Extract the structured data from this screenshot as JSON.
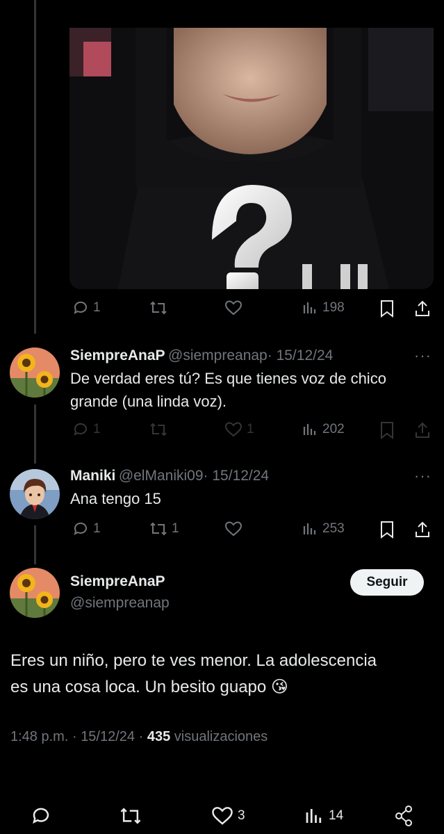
{
  "media_post": {
    "actions": {
      "reply_count": "1",
      "views": "198"
    }
  },
  "reply1": {
    "display_name": "SiempreAnaP",
    "handle": "@siempreanap",
    "date": "· 15/12/24",
    "more": "···",
    "text_line1": "De verdad eres tú? Es que tienes voz de chico",
    "text_line2": "grande (una linda voz).",
    "reply_count": "1",
    "like_count": "1",
    "views": "202"
  },
  "reply2": {
    "display_name": "Maniki",
    "handle": "@elManiki09",
    "date": "· 15/12/24",
    "more": "···",
    "text": "Ana tengo 15",
    "reply_count": "1",
    "repost_count": "1",
    "views": "253"
  },
  "main_post": {
    "display_name": "SiempreAnaP",
    "handle": "@siempreanap",
    "follow_label": "Seguir",
    "text_line1": "Eres un niño, pero te ves menor. La adolescencia",
    "text_line2": "es una cosa loca. Un besito guapo",
    "emoji": "😘",
    "time": "1:48 p.m.",
    "sep1": "·",
    "date": "15/12/24",
    "sep2": "·",
    "views_count": "435",
    "views_label": "visualizaciones"
  },
  "bottom_bar": {
    "like_count": "3",
    "views": "14"
  },
  "colors": {
    "background": "#000000",
    "text": "#e7e9ea",
    "muted": "#71767b",
    "button_bg": "#eff3f4"
  }
}
